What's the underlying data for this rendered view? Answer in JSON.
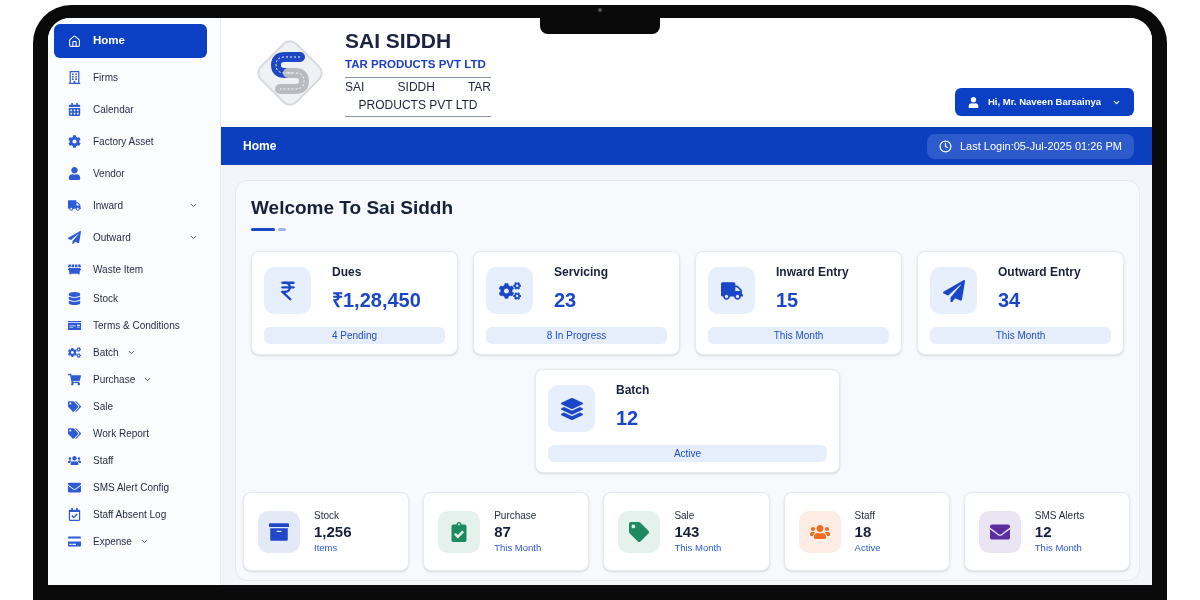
{
  "sidebar": {
    "items": [
      {
        "label": "Home",
        "kind": "link",
        "selected": true
      },
      {
        "label": "Firms",
        "kind": "link",
        "selected": false
      },
      {
        "label": "Calendar",
        "kind": "link",
        "selected": false
      },
      {
        "label": "Factory Asset",
        "kind": "link",
        "selected": false
      },
      {
        "label": "Vendor",
        "kind": "link",
        "selected": false
      },
      {
        "label": "Inward",
        "kind": "expandable",
        "selected": false
      },
      {
        "label": "Outward",
        "kind": "expandable",
        "selected": false
      },
      {
        "label": "Waste Item",
        "kind": "link",
        "selected": false
      },
      {
        "label": "Stock",
        "kind": "link",
        "selected": false
      },
      {
        "label": "Terms & Conditions",
        "kind": "link",
        "selected": false
      },
      {
        "label": "Batch",
        "kind": "dropdown",
        "selected": false
      },
      {
        "label": "Purchase",
        "kind": "dropdown",
        "selected": false
      },
      {
        "label": "Sale",
        "kind": "link",
        "selected": false
      },
      {
        "label": "Work Report",
        "kind": "link",
        "selected": false
      },
      {
        "label": "Staff",
        "kind": "link",
        "selected": false
      },
      {
        "label": "SMS Alert Config",
        "kind": "link",
        "selected": false
      },
      {
        "label": "Staff Absent Log",
        "kind": "link",
        "selected": false
      },
      {
        "label": "Expense",
        "kind": "dropdown",
        "selected": false
      }
    ]
  },
  "header": {
    "logo": {
      "name": "SAI SIDDH",
      "subtitle": "TAR PRODUCTS PVT LTD",
      "tagline": "SAI SIDDH TAR PRODUCTS PVT LTD"
    },
    "user_menu": {
      "label": "Hi, Mr. Naveen Barsainya"
    }
  },
  "page_bar": {
    "title": "Home",
    "last_login": "Last Login:05-Jul-2025 01:26 PM"
  },
  "dashboard": {
    "title": "Welcome To Sai Siddh",
    "summary_cards": [
      {
        "title": "Dues",
        "value": "₹1,28,450",
        "status": "4 Pending"
      },
      {
        "title": "Servicing",
        "value": "23",
        "status": "8 In Progress"
      },
      {
        "title": "Inward Entry",
        "value": "15",
        "status": "This Month"
      },
      {
        "title": "Outward Entry",
        "value": "34",
        "status": "This Month"
      }
    ],
    "featured_card": {
      "title": "Batch",
      "value": "12",
      "status": "Active"
    },
    "stats": [
      {
        "label": "Stock",
        "value": "1,256",
        "note": "Items",
        "color": "#1e47c9"
      },
      {
        "label": "Purchase",
        "value": "87",
        "note": "This Month",
        "color": "#1f8a5f"
      },
      {
        "label": "Sale",
        "value": "143",
        "note": "This Month",
        "color": "#1f8a5f"
      },
      {
        "label": "Staff",
        "value": "18",
        "note": "Active",
        "color": "#f26b22"
      },
      {
        "label": "SMS Alerts",
        "value": "12",
        "note": "This Month",
        "color": "#5b2ca0"
      }
    ]
  }
}
